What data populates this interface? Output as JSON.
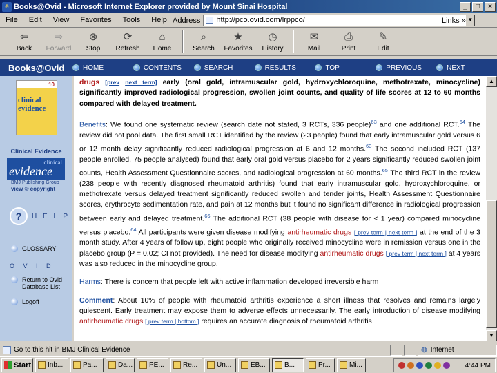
{
  "window": {
    "title": "Books@Ovid - Microsoft Internet Explorer provided by Mount Sinai Hospital",
    "controls": [
      "_",
      "□",
      "×"
    ]
  },
  "menu": [
    "File",
    "Edit",
    "View",
    "Favorites",
    "Tools",
    "Help"
  ],
  "address": {
    "label": "Address",
    "url": "http://pco.ovid.com/lrppco/",
    "links_label": "Links »"
  },
  "toolbar": {
    "back": "Back",
    "forward": "Forward",
    "stop": "Stop",
    "refresh": "Refresh",
    "home": "Home",
    "search": "Search",
    "favorites": "Favorites",
    "history": "History",
    "mail": "Mail",
    "print": "Print",
    "edit": "Edit"
  },
  "ovidnav": {
    "brand": "Books@Ovid",
    "items": [
      "HOME",
      "CONTENTS",
      "SEARCH",
      "RESULTS",
      "TOP",
      "PREVIOUS",
      "NEXT"
    ]
  },
  "sidebar": {
    "book_edition": "10",
    "book_title": "clinical evidence",
    "caption": "Clinical Evidence",
    "logo_small": "clinical",
    "logo_big": "evidence",
    "publisher": "BMJ Publishing Group",
    "view_copyright": "view © copyright",
    "help": "H E L P",
    "glossary": "GLOSSARY",
    "ovid": "O V I D",
    "return_label_1": "Return to Ovid",
    "return_label_2": "Database List",
    "logoff": "Logoff"
  },
  "content": {
    "heading_drug": "drugs",
    "heading_prev": "[prev",
    "heading_next": "next term]",
    "heading_rest": " early (oral gold, intramuscular gold, hydroxychloroquine, methotrexate, minocycline) significantly improved radiological progression, swollen joint counts, and quality of life scores at 12 to 60 months compared with delayed treatment.",
    "benefits_label": "Benefits",
    "benefits_1": ": We found one systematic review (search date not stated, 3 RCTs, 336 people)",
    "ref_63a": "63",
    "benefits_2": " and one additional RCT.",
    "ref_64a": "64",
    "benefits_3": " The review did not pool data. The first small RCT identified by the review (23 people) found that early intramuscular gold versus 6 or 12 month delay significantly reduced radiological progression at 6 and 12 months.",
    "ref_63b": "63",
    "benefits_4": " The second included RCT (137 people enrolled, 75 people analysed) found that early oral gold versus placebo for 2 years significantly reduced swollen joint counts, Health Assessment Questionnaire scores, and radiological progression at 60 months.",
    "ref_65": "65",
    "benefits_5": " The third RCT in the review (238 people with recently diagnosed rheumatoid arthritis) found that early intramuscular gold, hydroxychloroquine, or methotrexate versus delayed treatment significantly reduced swollen and tender joints, Health Assessment Questionnaire scores, erythrocyte sedimentation rate, and pain at 12 months but it found no significant difference in radiological progression between early and delayed treatment.",
    "ref_66": "66",
    "benefits_6": " The additional RCT (38 people with disease for < 1 year) compared minocycline versus placebo.",
    "ref_64b": "64",
    "benefits_7": " All participants were given disease modifying ",
    "term_1": "antirheumatic drugs",
    "term_1_links": "[ prev term | next term ]",
    "benefits_8": " at the end of the 3 month study. After 4 years of follow up, eight people who originally received minocycline were in remission versus one in the placebo group (P = 0.02; CI not provided). The need for disease modifying ",
    "term_2": "antirheumatic drugs",
    "term_2_links": "[ prev term | next term ]",
    "benefits_9": " at 4 years was also reduced in the minocycline group.",
    "harms_label": "Harms",
    "harms_text": ": There is concern that people left with active inflammation developed irreversible harm",
    "comment_label": "Comment",
    "comment_1": ": About 10% of people with rheumatoid arthritis experience a short illness that resolves and remains largely quiescent. Early treatment may expose them to adverse effects unnecessarily. The early introduction of disease modifying ",
    "term_3": "antirheumatic drugs",
    "term_3_links": "[ prev term | bottom ]",
    "comment_2": " requires an accurate diagnosis of rheumatoid arthritis"
  },
  "status": {
    "message": "Go to this hit in BMJ Clinical Evidence",
    "zone": "Internet"
  },
  "taskbar": {
    "start": "Start",
    "items": [
      "Inb...",
      "Pa...",
      "Da...",
      "PE...",
      "Re...",
      "Un...",
      "EB...",
      "B...",
      "Pr...",
      "Mi..."
    ],
    "time": "4:44 PM"
  }
}
